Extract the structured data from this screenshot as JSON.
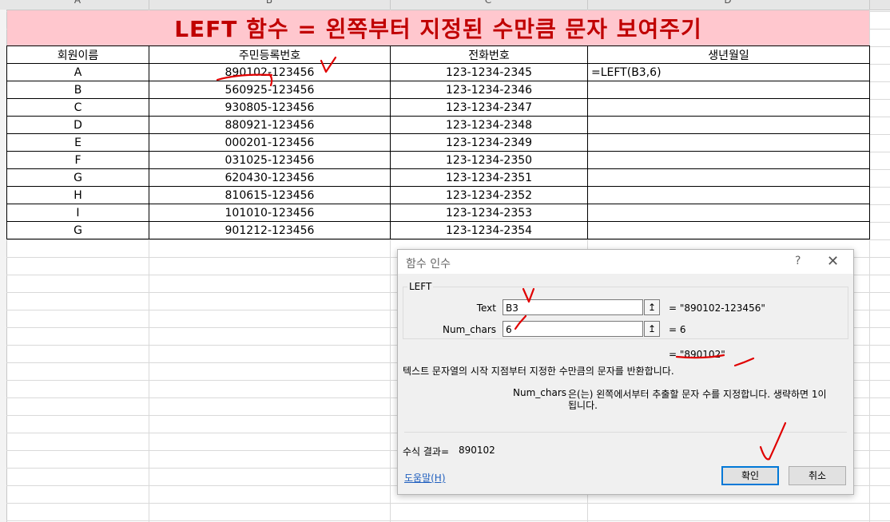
{
  "column_headers": [
    "A",
    "B",
    "C",
    "D"
  ],
  "title": "LEFT 함수 = 왼쪽부터 지정된 수만큼 문자 보여주기",
  "table": {
    "headers": [
      "회원이름",
      "주민등록번호",
      "전화번호",
      "생년월일"
    ],
    "rows": [
      [
        "A",
        "890102-123456",
        "123-1234-2345",
        "=LEFT(B3,6)"
      ],
      [
        "B",
        "560925-123456",
        "123-1234-2346",
        ""
      ],
      [
        "C",
        "930805-123456",
        "123-1234-2347",
        ""
      ],
      [
        "D",
        "880921-123456",
        "123-1234-2348",
        ""
      ],
      [
        "E",
        "000201-123456",
        "123-1234-2349",
        ""
      ],
      [
        "F",
        "031025-123456",
        "123-1234-2350",
        ""
      ],
      [
        "G",
        "620430-123456",
        "123-1234-2351",
        ""
      ],
      [
        "H",
        "810615-123456",
        "123-1234-2352",
        ""
      ],
      [
        "I",
        "101010-123456",
        "123-1234-2353",
        ""
      ],
      [
        "G",
        "901212-123456",
        "123-1234-2354",
        ""
      ]
    ]
  },
  "dialog": {
    "title": "함수 인수",
    "help": "?",
    "close": "✕",
    "function_name": "LEFT",
    "args": [
      {
        "label": "Text",
        "value": "B3",
        "result": "=  \"890102-123456\""
      },
      {
        "label": "Num_chars",
        "value": "6",
        "result": "=  6"
      }
    ],
    "function_result": "=  \"890102\"",
    "description": "텍스트 문자열의 시작 지점부터 지정한 수만큼의 문자를 반환합니다.",
    "arg_help_name": "Num_chars",
    "arg_help_text_1": "은(는) 왼쪽에서부터 추출할 문자 수를 지정합니다. 생략하면 1이",
    "arg_help_text_2": "됩니다.",
    "formula_result_label": "수식 결과=",
    "formula_result_value": "890102",
    "help_link": "도움말(H)",
    "ok_label": "확인",
    "cancel_label": "취소"
  },
  "colors": {
    "title_bg": "#ffc7ce",
    "title_text": "#c00000",
    "annotation": "#e00000",
    "ok_border": "#0078d7"
  }
}
